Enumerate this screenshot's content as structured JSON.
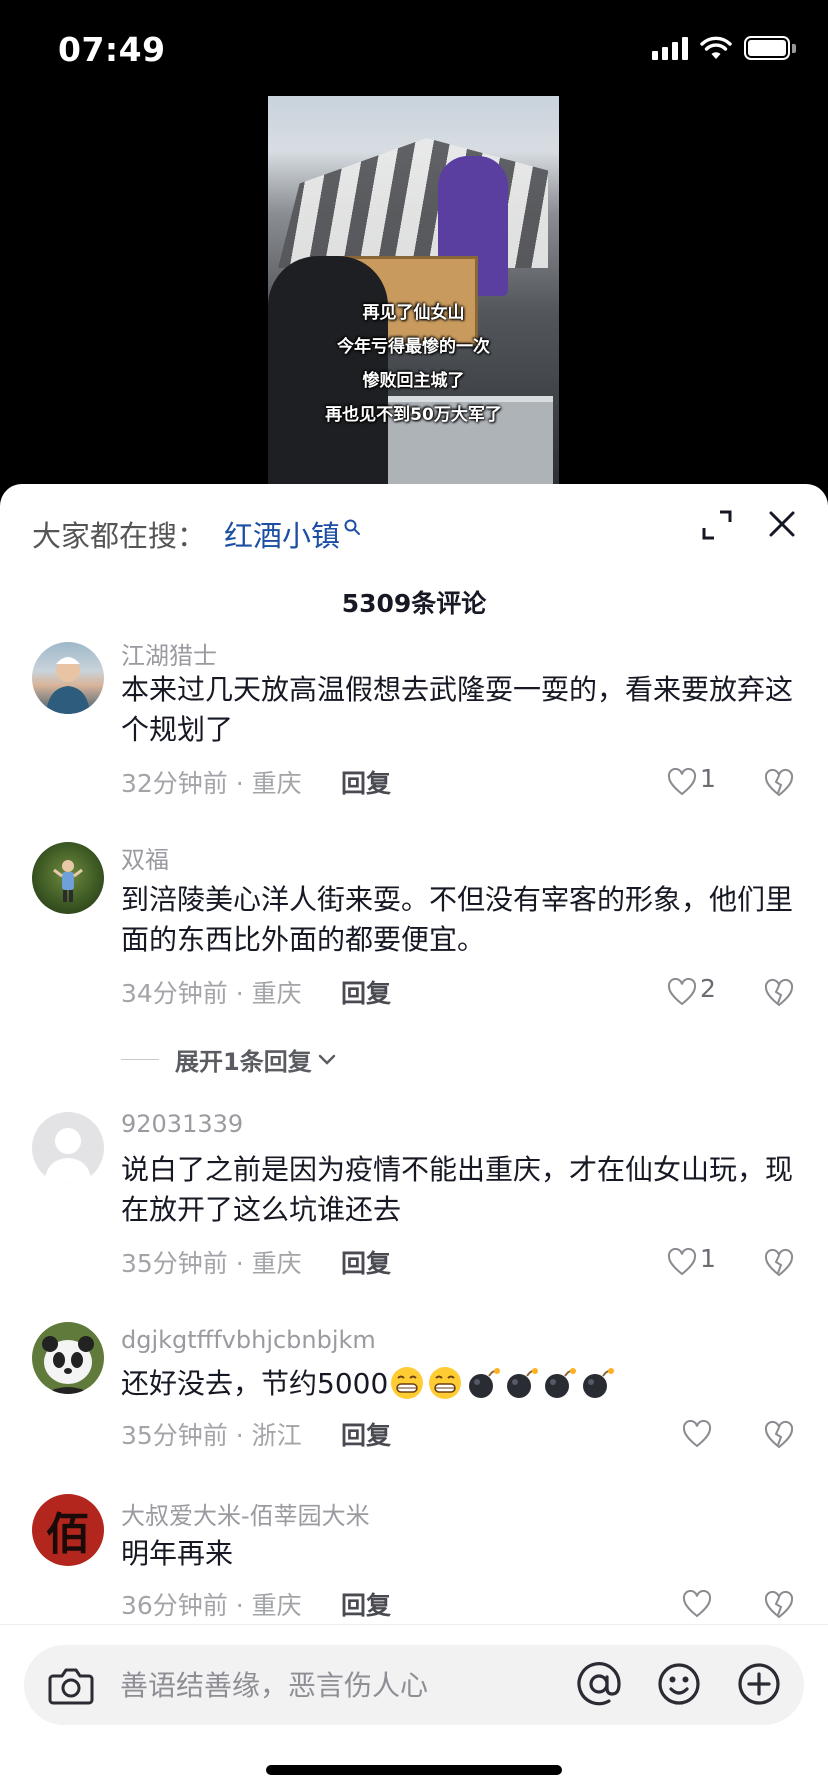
{
  "status_bar": {
    "time": "07:49"
  },
  "video": {
    "caption_lines": [
      "再见了仙女山",
      "今年亏得最惨的一次",
      "惨败回主城了",
      "再也见不到50万大军了"
    ]
  },
  "sheet": {
    "search_prefix": "大家都在搜：",
    "search_term": "红酒小镇",
    "comment_count": "5309条评论"
  },
  "comments": [
    {
      "user": "江湖猎士",
      "text": "本来过几天放高温假想去武隆耍一耍的，看来要放弃这个规划了",
      "meta": "32分钟前 · 重庆",
      "reply": "回复",
      "likes": "1"
    },
    {
      "user": "双福",
      "text": "到涪陵美心洋人街来耍。不但没有宰客的形象，他们里面的东西比外面的都要便宜。",
      "meta": "34分钟前 · 重庆",
      "reply": "回复",
      "likes": "2"
    },
    {
      "user": "92031339",
      "text": "说白了之前是因为疫情不能出重庆，才在仙女山玩，现在放开了这么坑谁还去",
      "meta": "35分钟前 · 重庆",
      "reply": "回复",
      "likes": "1"
    },
    {
      "user": "dgjkgtfffvbhjcbnbjkm",
      "text": "还好没去，节约5000",
      "meta": "35分钟前 · 浙江",
      "reply": "回复",
      "likes": ""
    },
    {
      "user": "大叔爱大米-佰莘园大米",
      "text": "明年再来",
      "meta": "36分钟前 · 重庆",
      "reply": "回复",
      "likes": ""
    }
  ],
  "expand_replies": "展开1条回复",
  "avatar_glyph_5": "佰",
  "input": {
    "placeholder": "善语结善缘，恶言伤人心"
  }
}
